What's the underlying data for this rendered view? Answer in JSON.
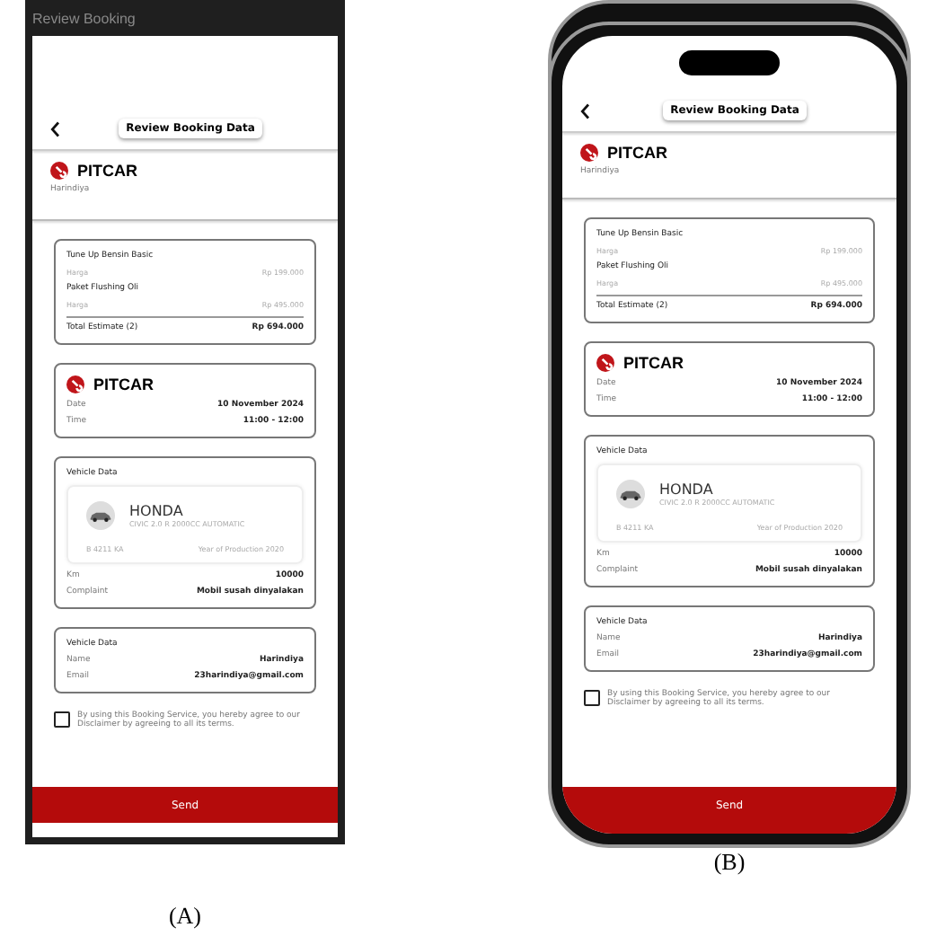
{
  "panels": [
    {
      "kind": "window",
      "title": "Review Booking",
      "caption": "(A)",
      "screen": {
        "header": "Review Booking Data",
        "brand": "PITCAR",
        "user": "Harindiya",
        "services": [
          {
            "name": "Tune Up Bensin Basic",
            "label": "Harga",
            "price": "Rp 199.000"
          },
          {
            "name": "Paket Flushing Oli",
            "label": "Harga",
            "price": "Rp 495.000"
          }
        ],
        "total_label": "Total Estimate (2)",
        "total_value": "Rp 694.000",
        "schedule": {
          "brand": "PITCAR",
          "rows": [
            {
              "label": "Date",
              "value": "10 November 2024"
            },
            {
              "label": "Time",
              "value": "11:00 - 12:00"
            }
          ]
        },
        "vehicle": {
          "title": "Vehicle Data",
          "make": "HONDA",
          "model": "CIVIC 2.0 R 2000CC AUTOMATIC",
          "plate": "B 4211 KA",
          "year": "Year of Production 2020",
          "rows": [
            {
              "label": "Km",
              "value": "10000"
            },
            {
              "label": "Complaint",
              "value": "Mobil susah dinyalakan"
            }
          ]
        },
        "customer": {
          "title": "Vehicle Data",
          "rows": [
            {
              "label": "Name",
              "value": "Harindiya"
            },
            {
              "label": "Email",
              "value": "23harindiya@gmail.com"
            }
          ]
        },
        "agreement": {
          "text": "By using this Booking Service, you hereby agree to our Disclaimer by agreeing to all its terms.",
          "checked": false
        },
        "send": "Send"
      }
    },
    {
      "kind": "phone",
      "caption": "(B)",
      "screen": {
        "header": "Review Booking Data",
        "brand": "PITCAR",
        "user": "Harindiya",
        "services": [
          {
            "name": "Tune Up Bensin Basic",
            "label": "Harga",
            "price": "Rp 199.000"
          },
          {
            "name": "Paket Flushing Oli",
            "label": "Harga",
            "price": "Rp 495.000"
          }
        ],
        "total_label": "Total Estimate (2)",
        "total_value": "Rp 694.000",
        "schedule": {
          "brand": "PITCAR",
          "rows": [
            {
              "label": "Date",
              "value": "10 November 2024"
            },
            {
              "label": "Time",
              "value": "11:00 - 12:00"
            }
          ]
        },
        "vehicle": {
          "title": "Vehicle Data",
          "make": "HONDA",
          "model": "CIVIC 2.0 R 2000CC AUTOMATIC",
          "plate": "B 4211 KA",
          "year": "Year of Production 2020",
          "rows": [
            {
              "label": "Km",
              "value": "10000"
            },
            {
              "label": "Complaint",
              "value": "Mobil susah dinyalakan"
            }
          ]
        },
        "customer": {
          "title": "Vehicle Data",
          "rows": [
            {
              "label": "Name",
              "value": "Harindiya"
            },
            {
              "label": "Email",
              "value": "23harindiya@gmail.com"
            }
          ]
        },
        "agreement": {
          "text": "By using this Booking Service, you hereby agree to our Disclaimer by agreeing to all its terms.",
          "checked": false
        },
        "send": "Send"
      }
    }
  ]
}
